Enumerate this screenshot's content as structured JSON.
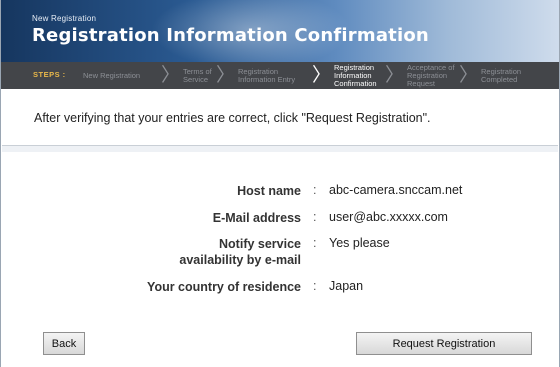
{
  "header": {
    "subtitle": "New Registration",
    "title": "Registration Information Confirmation"
  },
  "steps": {
    "label": "STEPS :",
    "items": [
      {
        "label": "New Registration",
        "active": false
      },
      {
        "label": "Terms of\nService",
        "active": false
      },
      {
        "label": "Registration\nInformation Entry",
        "active": false
      },
      {
        "label": "Registration\nInformation\nConfirmation",
        "active": true
      },
      {
        "label": "Acceptance of\nRegistration\nRequest",
        "active": false
      },
      {
        "label": "Registration\nCompleted",
        "active": false
      }
    ]
  },
  "instruction": "After verifying that your entries are correct, click \"Request Registration\".",
  "details": [
    {
      "label": "Host name",
      "value": "abc-camera.snccam.net"
    },
    {
      "label": "E-Mail address",
      "value": "user@abc.xxxxx.com"
    },
    {
      "label": "Notify service\navailability by e-mail",
      "value": "Yes please"
    },
    {
      "label": "Your country of residence",
      "value": "Japan"
    }
  ],
  "separator": ":",
  "buttons": {
    "back": "Back",
    "request": "Request Registration"
  }
}
